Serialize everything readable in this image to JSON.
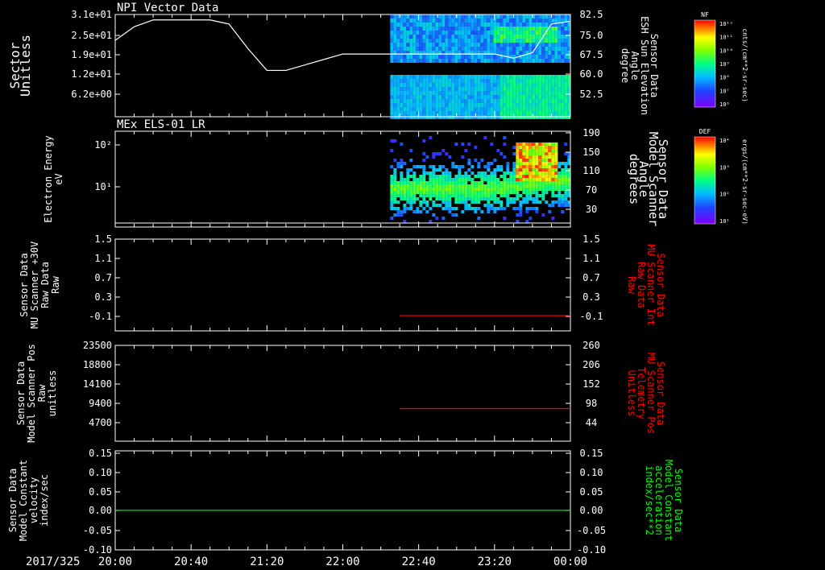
{
  "date_label": "2017/325",
  "time_ticks": [
    "20:00",
    "20:40",
    "21:20",
    "22:00",
    "22:40",
    "23:20",
    "00:00"
  ],
  "colors": {
    "red": "#ff0000",
    "green": "#00ff00",
    "white": "#ffffff"
  },
  "colorbars": [
    {
      "label": "NF",
      "units": "cnts/(cm**2-sr-sec)",
      "ticks": [
        "10¹²",
        "10¹¹",
        "10¹⁰",
        "10⁹",
        "10⁸",
        "10⁷",
        "10⁶"
      ]
    },
    {
      "label": "DEF",
      "units": "ergs/(cm**2-sr-sec-eV)",
      "ticks": [
        "10⁴",
        "10³",
        "10²",
        "10¹"
      ]
    }
  ],
  "chart_data": [
    {
      "type": "line",
      "title": "NPI Vector Data",
      "ylabel": [
        "Sector",
        "Unitless"
      ],
      "left_ticks": [
        "3.1e+01",
        "2.5e+01",
        "1.9e+01",
        "1.2e+01",
        "6.2e+00"
      ],
      "right_ticks": [
        "82.5",
        "75.0",
        "67.5",
        "60.0",
        "52.5"
      ],
      "ylabel_right": [
        "Sensor Data",
        "ESH Sun Elevation",
        "Angle",
        "degree"
      ],
      "right_ylim": [
        45,
        82.5
      ],
      "x": [
        "20:00",
        "20:10",
        "20:20",
        "20:30",
        "20:40",
        "20:50",
        "21:00",
        "21:10",
        "21:20",
        "21:30",
        "21:40",
        "21:50",
        "22:00",
        "22:10",
        "22:20",
        "22:30",
        "22:40",
        "22:50",
        "23:00",
        "23:10",
        "23:20",
        "23:30",
        "23:40",
        "23:50",
        "00:00"
      ],
      "series": [
        {
          "values": [
            73,
            78,
            80.5,
            80.5,
            80.5,
            80.5,
            79,
            70,
            62,
            62,
            64,
            66,
            68,
            68,
            68,
            68,
            68,
            68,
            68,
            68,
            68,
            66.5,
            68.5,
            79,
            80
          ]
        }
      ],
      "spectrogram": {
        "start": "22:25",
        "end": "00:00",
        "colorbar": "NF"
      }
    },
    {
      "type": "heatmap",
      "title": "MEx ELS-01 LR",
      "ylabel": [
        "Electron Energy",
        "eV"
      ],
      "left_ticks": [
        "10²",
        "10¹"
      ],
      "right_ticks": [
        "190",
        "150",
        "110",
        "70",
        "30"
      ],
      "ylabel_right": [
        "Sensor Data",
        "Model Scanner",
        "Angle",
        "degrees"
      ],
      "right_ylim": [
        0,
        190
      ],
      "line": {
        "values": [
          8,
          8
        ],
        "label_axis": "right"
      },
      "spectrogram": {
        "start": "22:25",
        "end": "00:00",
        "colorbar": "DEF"
      }
    },
    {
      "type": "line",
      "ylabel": [
        "Sensor Data",
        "MU Scanner +30V",
        "Raw Data",
        "Raw"
      ],
      "left_ticks": [
        "1.5",
        "1.1",
        "0.7",
        "0.3",
        "-0.1"
      ],
      "right_ticks": [
        "1.5",
        "1.1",
        "0.7",
        "0.3",
        "-0.1"
      ],
      "ylabel_right": [
        "Sensor Data",
        "MU Scanner Int",
        "Raw Data",
        "Raw"
      ],
      "ylim": [
        -0.3,
        1.5
      ],
      "series": [
        {
          "start": "22:30",
          "end": "00:00",
          "value": 0.0,
          "color": "red"
        }
      ]
    },
    {
      "type": "line",
      "ylabel": [
        "Sensor Data",
        "Model Scanner Pos",
        "Raw",
        "unitless"
      ],
      "left_ticks": [
        "23500",
        "18800",
        "14100",
        "9400",
        "4700"
      ],
      "right_ticks": [
        "260",
        "206",
        "152",
        "98",
        "44"
      ],
      "ylabel_right": [
        "Sensor Data",
        "MU Scanner Pos",
        "Telemetry",
        "Unitless"
      ],
      "ylim": [
        0,
        23500
      ],
      "right_ylim": [
        0,
        260
      ],
      "series": [
        {
          "start": "22:30",
          "end": "00:00",
          "value": 8000,
          "color": "red"
        }
      ]
    },
    {
      "type": "line",
      "ylabel": [
        "Sensor Data",
        "Model Constant",
        "velocity",
        "index/sec"
      ],
      "left_ticks": [
        "0.15",
        "0.10",
        "0.05",
        "0.00",
        "-0.05",
        "-0.10"
      ],
      "right_ticks": [
        "0.15",
        "0.10",
        "0.05",
        "0.00",
        "-0.05",
        "-0.10"
      ],
      "ylabel_right": [
        "Sensor Data",
        "Model Constant",
        "acceleration",
        "index/sec**2"
      ],
      "ylim": [
        -0.1,
        0.15
      ],
      "series": [
        {
          "start": "20:00",
          "end": "00:00",
          "value": 0.0,
          "color": "green"
        }
      ]
    }
  ]
}
